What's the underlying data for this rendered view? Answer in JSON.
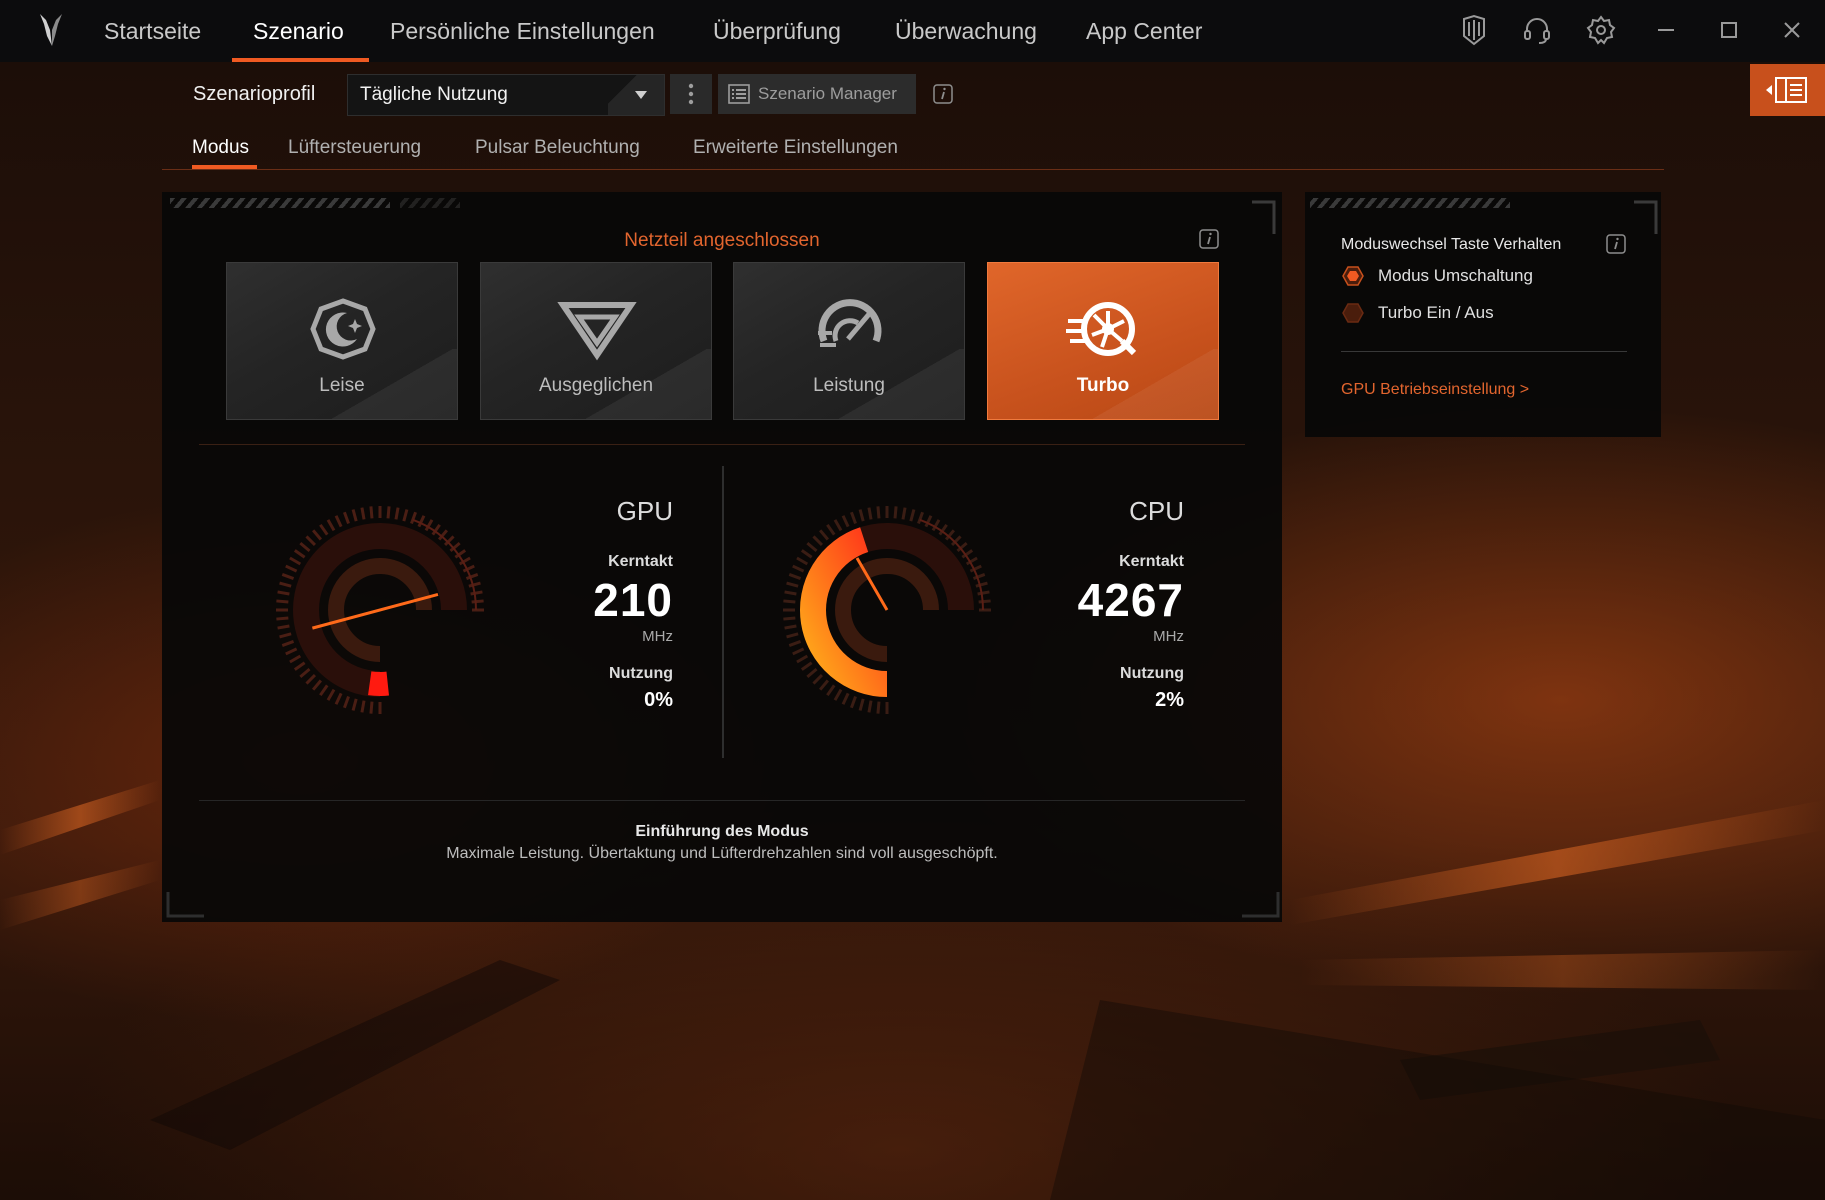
{
  "colors": {
    "accent": "#f05a22",
    "accent_dark": "#c8501c",
    "panel": "#0b0b0b"
  },
  "nav": {
    "items": [
      "Startseite",
      "Szenario",
      "Persönliche Einstellungen",
      "Überprüfung",
      "Überwachung",
      "App Center"
    ],
    "active": "Szenario",
    "icons": [
      "shield-icon",
      "headset-icon",
      "settings-icon"
    ]
  },
  "window_controls": [
    "minimize-icon",
    "maximize-icon",
    "close-icon"
  ],
  "toolbar": {
    "profile_label": "Szenarioprofil",
    "profile_value": "Tägliche Nutzung",
    "manager_label": "Szenario Manager"
  },
  "tabs": [
    "Modus",
    "Lüftersteuerung",
    "Pulsar Beleuchtung",
    "Erweiterte Einstellungen"
  ],
  "active_tab": "Modus",
  "power_status": "Netzteil angeschlossen",
  "modes": [
    {
      "label": "Leise",
      "icon": "moon-icon",
      "active": false
    },
    {
      "label": "Ausgeglichen",
      "icon": "balance-icon",
      "active": false
    },
    {
      "label": "Leistung",
      "icon": "speedometer-icon",
      "active": false
    },
    {
      "label": "Turbo",
      "icon": "turbo-icon",
      "active": true
    }
  ],
  "gpu": {
    "title": "GPU",
    "clock_label": "Kerntakt",
    "clock_value": "210",
    "clock_unit": "MHz",
    "usage_label": "Nutzung",
    "usage_value": "0%",
    "gauge_fraction": 0.03
  },
  "cpu": {
    "title": "CPU",
    "clock_label": "Kerntakt",
    "clock_value": "4267",
    "clock_unit": "MHz",
    "usage_label": "Nutzung",
    "usage_value": "2%",
    "gauge_fraction": 0.6
  },
  "intro": {
    "title": "Einführung des Modus",
    "text": "Maximale Leistung. Übertaktung und Lüfterdrehzahlen sind voll ausgeschöpft."
  },
  "side": {
    "title": "Moduswechsel Taste Verhalten",
    "options": [
      {
        "label": "Modus Umschaltung",
        "selected": true
      },
      {
        "label": "Turbo Ein / Aus",
        "selected": false
      }
    ],
    "link": "GPU Betriebseinstellung >"
  }
}
